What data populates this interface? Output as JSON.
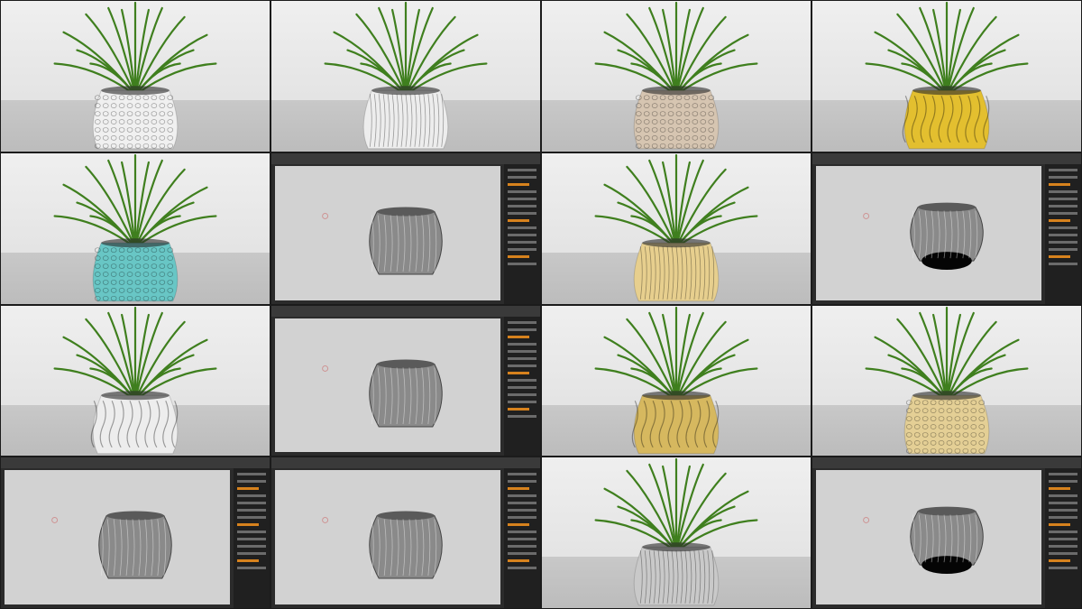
{
  "tiles": [
    {
      "kind": "photo",
      "name": "tile-1",
      "pot": "pot-white",
      "color": "#f0f0f0",
      "pattern": "cells"
    },
    {
      "kind": "photo",
      "name": "tile-2",
      "pot": "pot-white",
      "color": "#ededed",
      "pattern": "waves"
    },
    {
      "kind": "photo",
      "name": "tile-3",
      "pot": "pot-beige",
      "color": "#d6c5b1",
      "pattern": "cells"
    },
    {
      "kind": "photo",
      "name": "tile-4",
      "pot": "pot-yellow",
      "color": "#e3bf2f",
      "pattern": "swirl"
    },
    {
      "kind": "photo",
      "name": "tile-5",
      "pot": "pot-teal",
      "color": "#68c6c5",
      "pattern": "cells"
    },
    {
      "kind": "zbrush",
      "name": "tile-6",
      "render": "vase-render",
      "model": "cells"
    },
    {
      "kind": "photo",
      "name": "tile-7",
      "pot": "pot-tan",
      "color": "#e7cf8e",
      "pattern": "waves"
    },
    {
      "kind": "zbrush",
      "name": "tile-8",
      "render": "vase-render",
      "model": "swirl-inverted"
    },
    {
      "kind": "photo",
      "name": "tile-9",
      "pot": "pot-white",
      "color": "#ededed",
      "pattern": "swirl"
    },
    {
      "kind": "zbrush",
      "name": "tile-10",
      "render": "vase-render",
      "model": "waves"
    },
    {
      "kind": "photo",
      "name": "tile-11",
      "pot": "pot-mustard",
      "color": "#d6b85f",
      "pattern": "swirl"
    },
    {
      "kind": "photo",
      "name": "tile-12",
      "pot": "pot-tan",
      "color": "#e4cf95",
      "pattern": "cells"
    },
    {
      "kind": "zbrush",
      "name": "tile-13",
      "render": "vase-render",
      "model": "cells"
    },
    {
      "kind": "zbrush",
      "name": "tile-14",
      "render": "vase-render",
      "model": "cells-round"
    },
    {
      "kind": "photo",
      "name": "tile-15",
      "pot": "pot-grey",
      "color": "#c9c9c9",
      "pattern": "waves"
    },
    {
      "kind": "zbrush",
      "name": "tile-16",
      "render": "vase-render",
      "model": "swirl-inverted"
    }
  ]
}
